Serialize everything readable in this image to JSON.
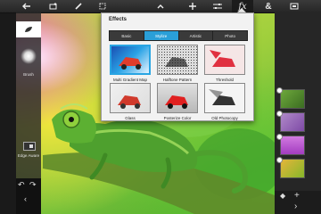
{
  "toolbar": {
    "buttons": [
      {
        "name": "back-arrow-icon",
        "glyph": "←"
      },
      {
        "name": "add-image-icon",
        "glyph": ""
      },
      {
        "name": "brush-tool-icon",
        "glyph": ""
      },
      {
        "name": "select-tool-icon",
        "glyph": ""
      },
      {
        "name": "collapse-chevron-icon",
        "glyph": "˄"
      },
      {
        "name": "add-icon",
        "glyph": "+"
      },
      {
        "name": "adjustments-icon",
        "glyph": ""
      },
      {
        "name": "fx-icon",
        "glyph": "fx"
      },
      {
        "name": "blend-ampersand-icon",
        "glyph": "&"
      },
      {
        "name": "fullscreen-icon",
        "glyph": ""
      }
    ]
  },
  "left_panel": {
    "brush_label": "Brush",
    "edge_label": "Edge Aware"
  },
  "effects": {
    "title": "Effects",
    "tabs": [
      "Basic",
      "Stylize",
      "Artistic",
      "Photo"
    ],
    "active_tab": "Stylize",
    "thumbnails": [
      {
        "label": "Multi Gradient Map",
        "selected": true
      },
      {
        "label": "Halftone Pattern",
        "selected": false
      },
      {
        "label": "Threshold",
        "selected": false
      },
      {
        "label": "Glass",
        "selected": false
      },
      {
        "label": "Posterize Color",
        "selected": false
      },
      {
        "label": "Old Photocopy",
        "selected": false
      }
    ]
  },
  "right_panel": {
    "layers": [
      {
        "name": "layer-1",
        "color": "#4c8a2a"
      },
      {
        "name": "layer-2",
        "color": "#9a5cc0"
      },
      {
        "name": "layer-3",
        "color": "#c061d4"
      },
      {
        "name": "layer-4",
        "color": "#8fbf2a"
      }
    ]
  },
  "colors": {
    "accent": "#2a9fd8",
    "toolbar_bg": "#2e2e2e"
  }
}
